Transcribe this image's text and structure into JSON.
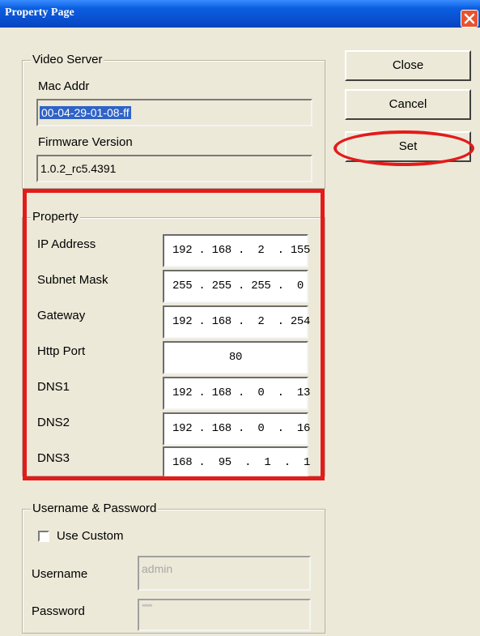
{
  "window": {
    "title": "Property Page"
  },
  "buttons": {
    "close": "Close",
    "cancel": "Cancel",
    "set": "Set"
  },
  "video_server": {
    "legend": "Video Server",
    "mac_label": "Mac Addr",
    "mac_value": "00-04-29-01-08-ff",
    "fw_label": "Firmware Version",
    "fw_value": "1.0.2_rc5.4391"
  },
  "property": {
    "legend": "Property",
    "rows": [
      {
        "label": "IP Address",
        "value": "192 . 168 .  2  . 155"
      },
      {
        "label": "Subnet Mask",
        "value": "255 . 255 . 255 .  0"
      },
      {
        "label": "Gateway",
        "value": "192 . 168 .  2  . 254"
      },
      {
        "label": "Http Port",
        "value": "80"
      },
      {
        "label": "DNS1",
        "value": "192 . 168 .  0  .  13"
      },
      {
        "label": "DNS2",
        "value": "192 . 168 .  0  .  16"
      },
      {
        "label": "DNS3",
        "value": "168 .  95  .  1  .  1"
      }
    ]
  },
  "credentials": {
    "legend": "Username & Password",
    "use_custom": "Use Custom",
    "use_custom_checked": false,
    "username_label": "Username",
    "username_value": "admin",
    "password_label": "Password",
    "password_value": "*****"
  },
  "annotation_colors": {
    "highlight": "#e31b1b"
  }
}
